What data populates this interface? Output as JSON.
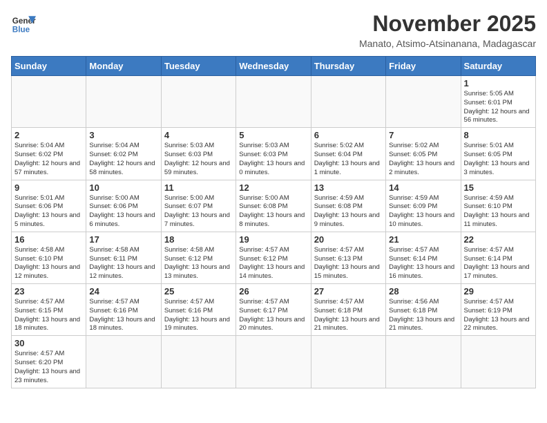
{
  "logo": {
    "line1": "General",
    "line2": "Blue"
  },
  "title": "November 2025",
  "subtitle": "Manato, Atsimo-Atsinanana, Madagascar",
  "days_of_week": [
    "Sunday",
    "Monday",
    "Tuesday",
    "Wednesday",
    "Thursday",
    "Friday",
    "Saturday"
  ],
  "weeks": [
    [
      {
        "day": "",
        "info": ""
      },
      {
        "day": "",
        "info": ""
      },
      {
        "day": "",
        "info": ""
      },
      {
        "day": "",
        "info": ""
      },
      {
        "day": "",
        "info": ""
      },
      {
        "day": "",
        "info": ""
      },
      {
        "day": "1",
        "info": "Sunrise: 5:05 AM\nSunset: 6:01 PM\nDaylight: 12 hours and 56 minutes."
      }
    ],
    [
      {
        "day": "2",
        "info": "Sunrise: 5:04 AM\nSunset: 6:02 PM\nDaylight: 12 hours and 57 minutes."
      },
      {
        "day": "3",
        "info": "Sunrise: 5:04 AM\nSunset: 6:02 PM\nDaylight: 12 hours and 58 minutes."
      },
      {
        "day": "4",
        "info": "Sunrise: 5:03 AM\nSunset: 6:03 PM\nDaylight: 12 hours and 59 minutes."
      },
      {
        "day": "5",
        "info": "Sunrise: 5:03 AM\nSunset: 6:03 PM\nDaylight: 13 hours and 0 minutes."
      },
      {
        "day": "6",
        "info": "Sunrise: 5:02 AM\nSunset: 6:04 PM\nDaylight: 13 hours and 1 minute."
      },
      {
        "day": "7",
        "info": "Sunrise: 5:02 AM\nSunset: 6:05 PM\nDaylight: 13 hours and 2 minutes."
      },
      {
        "day": "8",
        "info": "Sunrise: 5:01 AM\nSunset: 6:05 PM\nDaylight: 13 hours and 3 minutes."
      }
    ],
    [
      {
        "day": "9",
        "info": "Sunrise: 5:01 AM\nSunset: 6:06 PM\nDaylight: 13 hours and 5 minutes."
      },
      {
        "day": "10",
        "info": "Sunrise: 5:00 AM\nSunset: 6:06 PM\nDaylight: 13 hours and 6 minutes."
      },
      {
        "day": "11",
        "info": "Sunrise: 5:00 AM\nSunset: 6:07 PM\nDaylight: 13 hours and 7 minutes."
      },
      {
        "day": "12",
        "info": "Sunrise: 5:00 AM\nSunset: 6:08 PM\nDaylight: 13 hours and 8 minutes."
      },
      {
        "day": "13",
        "info": "Sunrise: 4:59 AM\nSunset: 6:08 PM\nDaylight: 13 hours and 9 minutes."
      },
      {
        "day": "14",
        "info": "Sunrise: 4:59 AM\nSunset: 6:09 PM\nDaylight: 13 hours and 10 minutes."
      },
      {
        "day": "15",
        "info": "Sunrise: 4:59 AM\nSunset: 6:10 PM\nDaylight: 13 hours and 11 minutes."
      }
    ],
    [
      {
        "day": "16",
        "info": "Sunrise: 4:58 AM\nSunset: 6:10 PM\nDaylight: 13 hours and 12 minutes."
      },
      {
        "day": "17",
        "info": "Sunrise: 4:58 AM\nSunset: 6:11 PM\nDaylight: 13 hours and 12 minutes."
      },
      {
        "day": "18",
        "info": "Sunrise: 4:58 AM\nSunset: 6:12 PM\nDaylight: 13 hours and 13 minutes."
      },
      {
        "day": "19",
        "info": "Sunrise: 4:57 AM\nSunset: 6:12 PM\nDaylight: 13 hours and 14 minutes."
      },
      {
        "day": "20",
        "info": "Sunrise: 4:57 AM\nSunset: 6:13 PM\nDaylight: 13 hours and 15 minutes."
      },
      {
        "day": "21",
        "info": "Sunrise: 4:57 AM\nSunset: 6:14 PM\nDaylight: 13 hours and 16 minutes."
      },
      {
        "day": "22",
        "info": "Sunrise: 4:57 AM\nSunset: 6:14 PM\nDaylight: 13 hours and 17 minutes."
      }
    ],
    [
      {
        "day": "23",
        "info": "Sunrise: 4:57 AM\nSunset: 6:15 PM\nDaylight: 13 hours and 18 minutes."
      },
      {
        "day": "24",
        "info": "Sunrise: 4:57 AM\nSunset: 6:16 PM\nDaylight: 13 hours and 18 minutes."
      },
      {
        "day": "25",
        "info": "Sunrise: 4:57 AM\nSunset: 6:16 PM\nDaylight: 13 hours and 19 minutes."
      },
      {
        "day": "26",
        "info": "Sunrise: 4:57 AM\nSunset: 6:17 PM\nDaylight: 13 hours and 20 minutes."
      },
      {
        "day": "27",
        "info": "Sunrise: 4:57 AM\nSunset: 6:18 PM\nDaylight: 13 hours and 21 minutes."
      },
      {
        "day": "28",
        "info": "Sunrise: 4:56 AM\nSunset: 6:18 PM\nDaylight: 13 hours and 21 minutes."
      },
      {
        "day": "29",
        "info": "Sunrise: 4:57 AM\nSunset: 6:19 PM\nDaylight: 13 hours and 22 minutes."
      }
    ],
    [
      {
        "day": "30",
        "info": "Sunrise: 4:57 AM\nSunset: 6:20 PM\nDaylight: 13 hours and 23 minutes."
      },
      {
        "day": "",
        "info": ""
      },
      {
        "day": "",
        "info": ""
      },
      {
        "day": "",
        "info": ""
      },
      {
        "day": "",
        "info": ""
      },
      {
        "day": "",
        "info": ""
      },
      {
        "day": "",
        "info": ""
      }
    ]
  ]
}
